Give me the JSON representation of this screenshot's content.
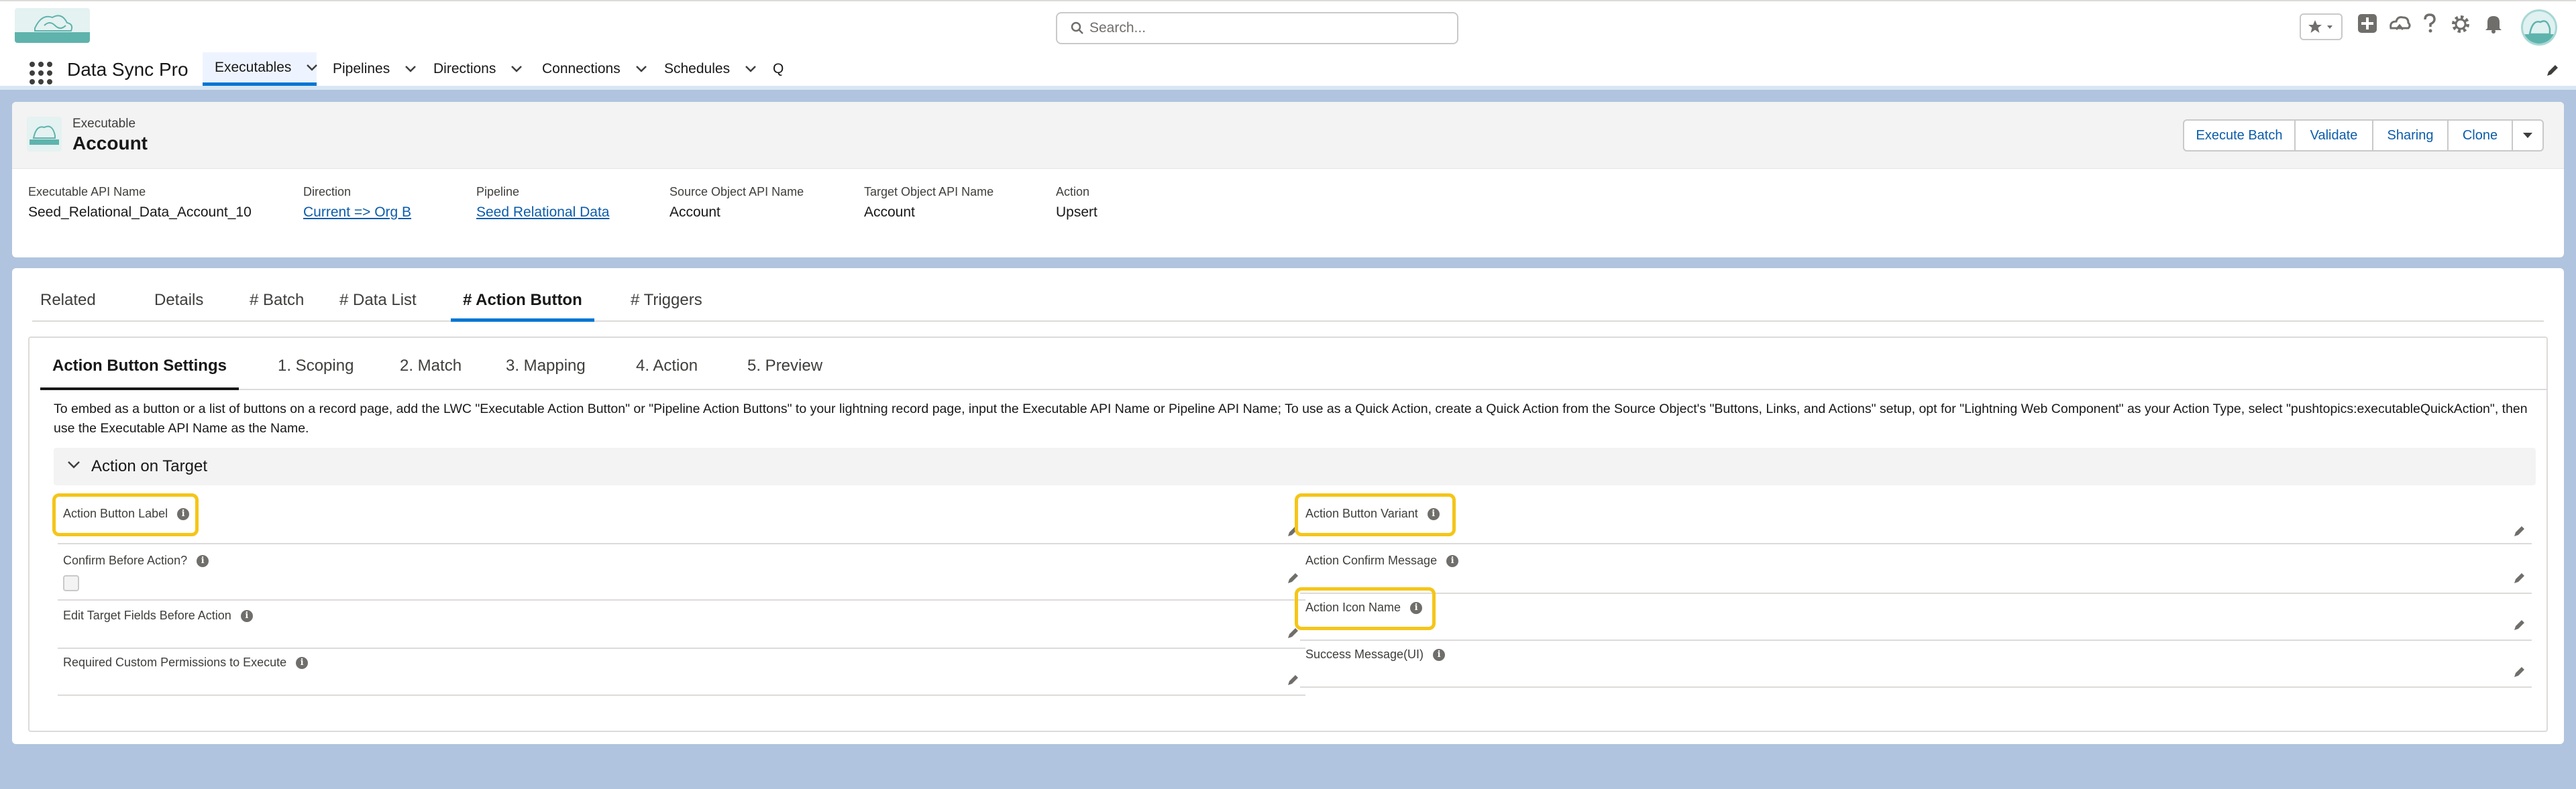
{
  "header": {
    "search_placeholder": "Search...",
    "icons": [
      "favorites-star-icon",
      "add-icon",
      "trailhead-icon",
      "help-icon",
      "setup-gear-icon",
      "notifications-bell-icon",
      "user-avatar"
    ]
  },
  "nav": {
    "app_name": "Data Sync Pro",
    "items": [
      {
        "label": "Executables",
        "active": true
      },
      {
        "label": "Pipelines"
      },
      {
        "label": "Directions"
      },
      {
        "label": "Connections"
      },
      {
        "label": "Schedules"
      },
      {
        "label": "Q"
      }
    ]
  },
  "record": {
    "object_type": "Executable",
    "title": "Account",
    "actions": [
      "Execute Batch",
      "Validate",
      "Sharing",
      "Clone"
    ],
    "fields": [
      {
        "label": "Executable API Name",
        "value": "Seed_Relational_Data_Account_10"
      },
      {
        "label": "Direction",
        "value": "Current => Org B",
        "link": true
      },
      {
        "label": "Pipeline",
        "value": "Seed Relational Data",
        "link": true
      },
      {
        "label": "Source Object API Name",
        "value": "Account"
      },
      {
        "label": "Target Object API Name",
        "value": "Account"
      },
      {
        "label": "Action",
        "value": "Upsert"
      }
    ]
  },
  "tabs": [
    "Related",
    "Details",
    "# Batch",
    "# Data List",
    "# Action Button",
    "# Triggers"
  ],
  "active_tab": "# Action Button",
  "subtabs": [
    "Action Button Settings",
    "1. Scoping",
    "2. Match",
    "3. Mapping",
    "4. Action",
    "5. Preview"
  ],
  "description": "To embed as a button or a list of buttons on a record page, add the LWC \"Executable Action Button\" or \"Pipeline Action Buttons\" to your lightning record page, input the Executable API Name or Pipeline API Name; To use as a Quick Action, create a Quick Action from the Source Object's \"Buttons, Links, and Actions\" setup, opt for \"Lightning Web Component\" as your Action Type, select \"pushtopics:executableQuickAction\", then use the Executable API Name as the Name.",
  "section_title": "Action on Target",
  "left_fields": [
    {
      "label": "Action Button Label",
      "highlighted": true
    },
    {
      "label": "Confirm Before Action?",
      "checkbox": true
    },
    {
      "label": "Edit Target Fields Before Action"
    },
    {
      "label": "Required Custom Permissions to Execute"
    }
  ],
  "right_fields": [
    {
      "label": "Action Button Variant",
      "highlighted": true
    },
    {
      "label": "Action Confirm Message"
    },
    {
      "label": "Action Icon Name",
      "highlighted": true
    },
    {
      "label": "Success Message(UI)"
    }
  ],
  "colors": {
    "brand": "#0176d3",
    "highlight": "#f5c518",
    "background": "#b0c4df"
  }
}
